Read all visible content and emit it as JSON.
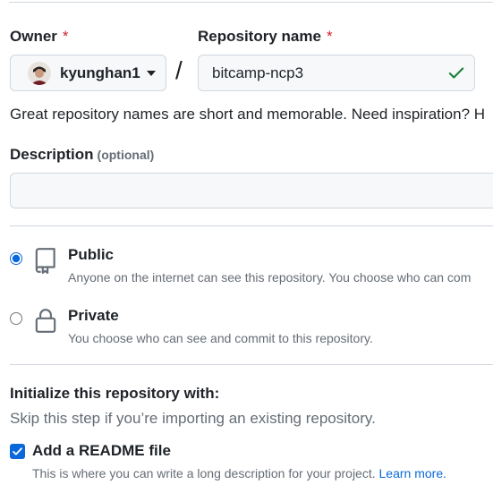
{
  "owner": {
    "label": "Owner",
    "required_mark": "*",
    "selected": "kyunghan1"
  },
  "repository": {
    "label": "Repository name",
    "required_mark": "*",
    "value": "bitcamp-ncp3",
    "separator": "/",
    "hint": "Great repository names are short and memorable. Need inspiration? H"
  },
  "description": {
    "label": "Description",
    "optional": "(optional)",
    "value": ""
  },
  "visibility": {
    "public": {
      "title": "Public",
      "description": "Anyone on the internet can see this repository. You choose who can com",
      "selected": true
    },
    "private": {
      "title": "Private",
      "description": "You choose who can see and commit to this repository.",
      "selected": false
    }
  },
  "initialize": {
    "title": "Initialize this repository with:",
    "hint": "Skip this step if you’re importing an existing repository.",
    "readme": {
      "label": "Add a README file",
      "description": "This is where you can write a long description for your project.",
      "link": "Learn more.",
      "checked": true
    }
  },
  "colors": {
    "accent": "#0969da",
    "success": "#1a7f37",
    "danger": "#cf222e",
    "border": "#d0d7de",
    "muted": "#656d76"
  }
}
